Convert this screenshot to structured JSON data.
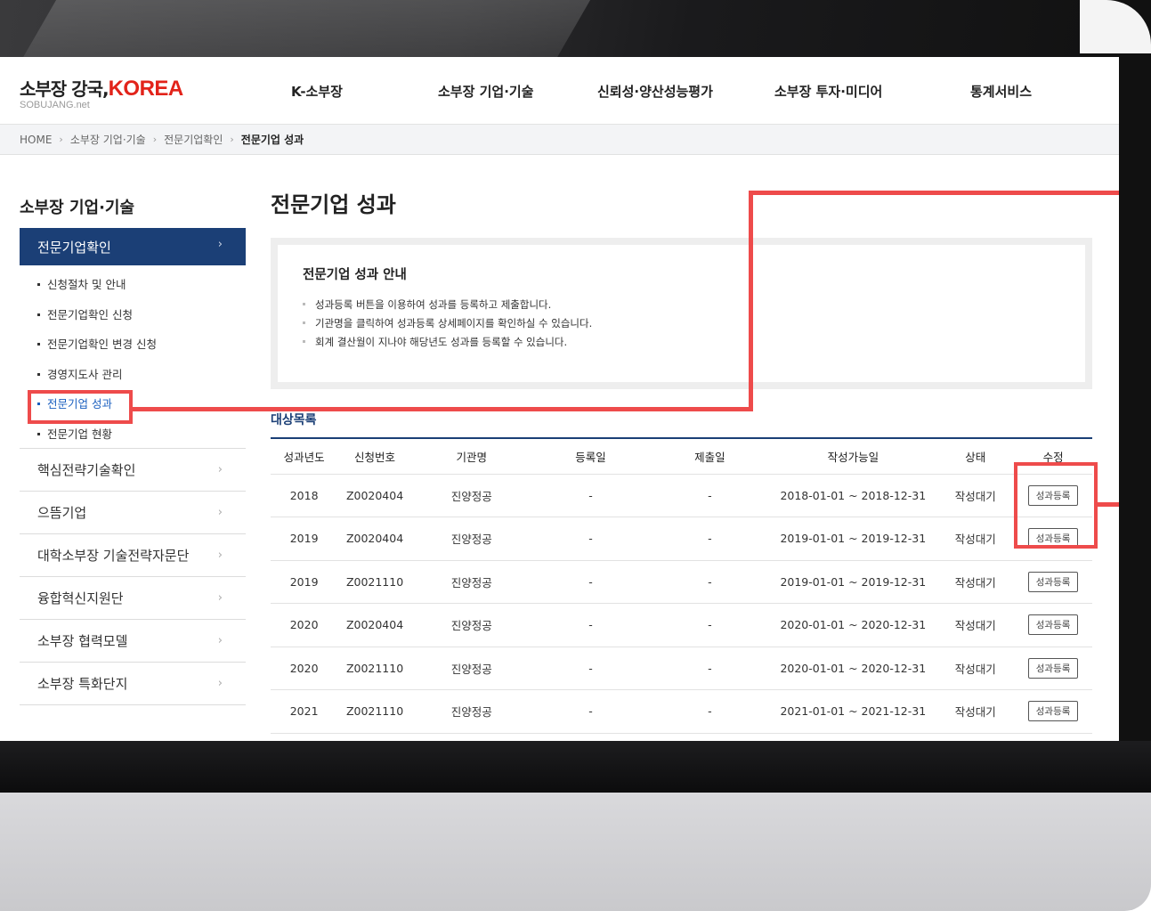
{
  "header": {
    "logo_text": "소부장 강국,",
    "logo_korea": "KOREA",
    "logo_sub": "SOBUJANG.net",
    "nav": [
      "K-소부장",
      "소부장 기업·기술",
      "신뢰성·양산성능평가",
      "소부장 투자·미디어",
      "통계서비스"
    ]
  },
  "breadcrumb": {
    "home": "HOME",
    "sep": "›",
    "items": [
      "소부장 기업·기술",
      "전문기업확인",
      "전문기업 성과"
    ]
  },
  "sidebar": {
    "title": "소부장 기업·기술",
    "active": "전문기업확인",
    "arrow": "›",
    "sub_items": [
      "신청절차 및 안내",
      "전문기업확인 신청",
      "전문기업확인 변경 신청",
      "경영지도사 관리",
      "전문기업 성과",
      "전문기업 현황"
    ],
    "items": [
      "핵심전략기술확인",
      "으뜸기업",
      "대학소부장 기술전략자문단",
      "융합혁신지원단",
      "소부장 협력모델",
      "소부장 특화단지"
    ]
  },
  "main": {
    "title": "전문기업 성과",
    "guide_title": "전문기업 성과 안내",
    "guide_items": [
      "성과등록 버튼을 이용하여 성과를 등록하고 제출합니다.",
      "기관명을 클릭하여 성과등록 상세페이지를 확인하실 수 있습니다.",
      "회계 결산월이 지나야 해당년도 성과를 등록할 수 있습니다."
    ],
    "list_title": "대상목록",
    "columns": [
      "성과년도",
      "신청번호",
      "기관명",
      "등록일",
      "제출일",
      "작성가능일",
      "상태",
      "수정"
    ],
    "rows": [
      {
        "year": "2018",
        "no": "Z0020404",
        "org": "진양정공",
        "reg": "-",
        "sub": "-",
        "period": "2018-01-01 ~ 2018-12-31",
        "status": "작성대기",
        "btn": "성과등록"
      },
      {
        "year": "2019",
        "no": "Z0020404",
        "org": "진양정공",
        "reg": "-",
        "sub": "-",
        "period": "2019-01-01 ~ 2019-12-31",
        "status": "작성대기",
        "btn": "성과등록"
      },
      {
        "year": "2019",
        "no": "Z0021110",
        "org": "진양정공",
        "reg": "-",
        "sub": "-",
        "period": "2019-01-01 ~ 2019-12-31",
        "status": "작성대기",
        "btn": "성과등록"
      },
      {
        "year": "2020",
        "no": "Z0020404",
        "org": "진양정공",
        "reg": "-",
        "sub": "-",
        "period": "2020-01-01 ~ 2020-12-31",
        "status": "작성대기",
        "btn": "성과등록"
      },
      {
        "year": "2020",
        "no": "Z0021110",
        "org": "진양정공",
        "reg": "-",
        "sub": "-",
        "period": "2020-01-01 ~ 2020-12-31",
        "status": "작성대기",
        "btn": "성과등록"
      },
      {
        "year": "2021",
        "no": "Z0021110",
        "org": "진양정공",
        "reg": "-",
        "sub": "-",
        "period": "2021-01-01 ~ 2021-12-31",
        "status": "작성대기",
        "btn": "성과등록"
      }
    ]
  },
  "colors": {
    "navy": "#1b3f76",
    "highlight": "#ee4b4b",
    "brand_red": "#e2231a",
    "link_blue": "#1a5fbf"
  }
}
